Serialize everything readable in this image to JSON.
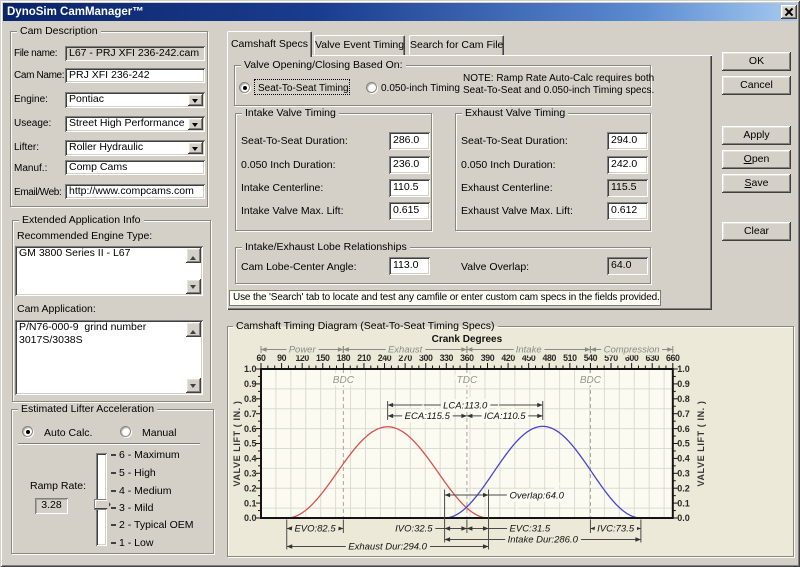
{
  "window": {
    "title": "DynoSim CamManager™"
  },
  "cam_description": {
    "caption": "Cam Description",
    "file_name": {
      "label": "File name:",
      "value": "L67 - PRJ XFI 236-242.cam"
    },
    "cam_name": {
      "label": "Cam Name:",
      "value": "PRJ XFI 236-242"
    },
    "engine": {
      "label": "Engine:",
      "value": "Pontiac"
    },
    "useage": {
      "label": "Useage:",
      "value": "Street High Performance"
    },
    "lifter": {
      "label": "Lifter:",
      "value": "Roller Hydraulic"
    },
    "manuf": {
      "label": "Manuf.:",
      "value": "Comp Cams"
    },
    "email_web": {
      "label": "Email/Web:",
      "value": "http://www.compcams.com"
    }
  },
  "extended_info": {
    "caption": "Extended Application Info",
    "engine_type_label": "Recommended Engine Type:",
    "engine_type_value": "GM 3800 Series II - L67",
    "cam_application_label": "Cam Application:",
    "cam_application_value": "P/N76-000-9  grind number\n3017S/3038S"
  },
  "lifter_acceleration": {
    "caption": "Estimated Lifter Acceleration",
    "options": [
      {
        "label": "Auto Calc.",
        "selected": true
      },
      {
        "label": "Manual",
        "selected": false
      }
    ],
    "ramp_rate_label": "Ramp Rate:",
    "ramp_rate_value": "3.28",
    "levels": [
      "6  -  Maximum",
      "5  -  High",
      "4  -  Medium",
      "3  -  Mild",
      "2  -  Typical OEM",
      "1  -  Low"
    ],
    "selected_level": "3  -  Mild"
  },
  "tabs": {
    "items": [
      "Camshaft Specs",
      "Valve Event Timing",
      "Search for Cam File"
    ],
    "active": "Camshaft Specs"
  },
  "valve_basis": {
    "caption": "Valve Opening/Closing Based On:",
    "options": [
      {
        "label": "Seat-To-Seat Timing",
        "selected": true
      },
      {
        "label": "0.050-inch Timing",
        "selected": false
      }
    ],
    "note_line1": "NOTE: Ramp Rate Auto-Calc requires both",
    "note_line2": "Seat-To-Seat and 0.050-inch Timing specs."
  },
  "intake_timing": {
    "caption": "Intake Valve Timing",
    "rows": [
      {
        "label": "Seat-To-Seat Duration:",
        "value": "286.0",
        "readonly": false
      },
      {
        "label": "0.050 Inch Duration:",
        "value": "236.0",
        "readonly": false
      },
      {
        "label": "Intake Centerline:",
        "value": "110.5",
        "readonly": false
      },
      {
        "label": "Intake Valve Max. Lift:",
        "value": "0.615",
        "readonly": false
      }
    ]
  },
  "exhaust_timing": {
    "caption": "Exhaust Valve Timing",
    "rows": [
      {
        "label": "Seat-To-Seat Duration:",
        "value": "294.0",
        "readonly": false
      },
      {
        "label": "0.050 Inch Duration:",
        "value": "242.0",
        "readonly": false
      },
      {
        "label": "Exhaust Centerline:",
        "value": "115.5",
        "readonly": true
      },
      {
        "label": "Exhaust Valve Max. Lift:",
        "value": "0.612",
        "readonly": false
      }
    ]
  },
  "lobe_relationships": {
    "caption": "Intake/Exhaust Lobe Relationships",
    "lobe_center": {
      "label": "Cam Lobe-Center Angle:",
      "value": "113.0",
      "readonly": false
    },
    "overlap": {
      "label": "Valve Overlap:",
      "value": "64.0",
      "readonly": true
    }
  },
  "instruction": "Use the 'Search' tab to locate and test any camfile or enter custom cam specs in the fields provided.",
  "action_buttons": [
    {
      "label": "OK"
    },
    {
      "label": "Cancel"
    },
    {
      "label": "Apply"
    },
    {
      "label": "Open",
      "accel": 0
    },
    {
      "label": "Save",
      "accel": 0
    },
    {
      "label": "Clear"
    }
  ],
  "chart_data": {
    "type": "line",
    "group_caption": "Camshaft Timing Diagram (Seat-To-Seat Timing Specs)",
    "title": "Crank Degrees",
    "x_axis": {
      "min": 60,
      "max": 660,
      "major_step": 30,
      "minor_step": 10,
      "label": "Crank Degrees"
    },
    "y_axis": {
      "min": 0.0,
      "max": 1.0,
      "major_step": 0.1,
      "minor_step": 0.05,
      "label": "VALVE LIFT ( IN. )"
    },
    "grid": true,
    "sections": [
      {
        "label": "Power",
        "from_deg": 60,
        "to_deg": 180
      },
      {
        "label": "Exhaust",
        "from_deg": 180,
        "to_deg": 360
      },
      {
        "label": "Intake",
        "from_deg": 360,
        "to_deg": 540
      },
      {
        "label": "Compression",
        "from_deg": 540,
        "to_deg": 660
      }
    ],
    "dead_centers": [
      {
        "label": "BDC",
        "deg": 180
      },
      {
        "label": "TDC",
        "deg": 360
      },
      {
        "label": "BDC",
        "deg": 540
      }
    ],
    "series": [
      {
        "name": "exhaust-lift",
        "color": "#d9514e",
        "shape": "raised-cosine",
        "center_deg": 244.5,
        "duration_deg": 294.0,
        "peak_lift": 0.612
      },
      {
        "name": "intake-lift",
        "color": "#4646d2",
        "shape": "raised-cosine",
        "center_deg": 470.5,
        "duration_deg": 286.0,
        "peak_lift": 0.615
      }
    ],
    "annotations": [
      {
        "id": "lca",
        "label": "LCA:113.0",
        "from_deg": 244.5,
        "to_deg": 470.5,
        "lift": 0.758,
        "text_pos": "center"
      },
      {
        "id": "eca",
        "label": "ECA:115.5",
        "from_deg": 244.5,
        "to_deg": 360.0,
        "lift": 0.685,
        "text_pos": "center"
      },
      {
        "id": "ica",
        "label": "ICA:110.5",
        "from_deg": 360.0,
        "to_deg": 470.5,
        "lift": 0.685,
        "text_pos": "center"
      },
      {
        "id": "overlap",
        "label": "Overlap:64.0",
        "from_deg": 327.5,
        "to_deg": 391.5,
        "lift": 0.154,
        "text_pos": "right"
      },
      {
        "id": "evo",
        "label": "EVO:82.5",
        "from_deg": 97.5,
        "to_deg": 180.0,
        "row": 1,
        "text_pos": "center"
      },
      {
        "id": "ivo",
        "label": "IVO:32.5",
        "from_deg": 327.5,
        "to_deg": 360.0,
        "row": 1,
        "text_pos": "left"
      },
      {
        "id": "evc",
        "label": "EVC:31.5",
        "from_deg": 360.0,
        "to_deg": 391.5,
        "row": 1,
        "text_pos": "right"
      },
      {
        "id": "ivc",
        "label": "IVC:73.5",
        "from_deg": 540.0,
        "to_deg": 613.5,
        "row": 1,
        "text_pos": "center"
      },
      {
        "id": "intake_dur",
        "label": "Intake Dur:286.0",
        "from_deg": 327.5,
        "to_deg": 613.5,
        "row": 2,
        "text_pos": "center"
      },
      {
        "id": "exhaust_dur",
        "label": "Exhaust Dur:294.0",
        "from_deg": 97.5,
        "to_deg": 391.5,
        "row": 3,
        "text_pos": "center"
      }
    ]
  }
}
